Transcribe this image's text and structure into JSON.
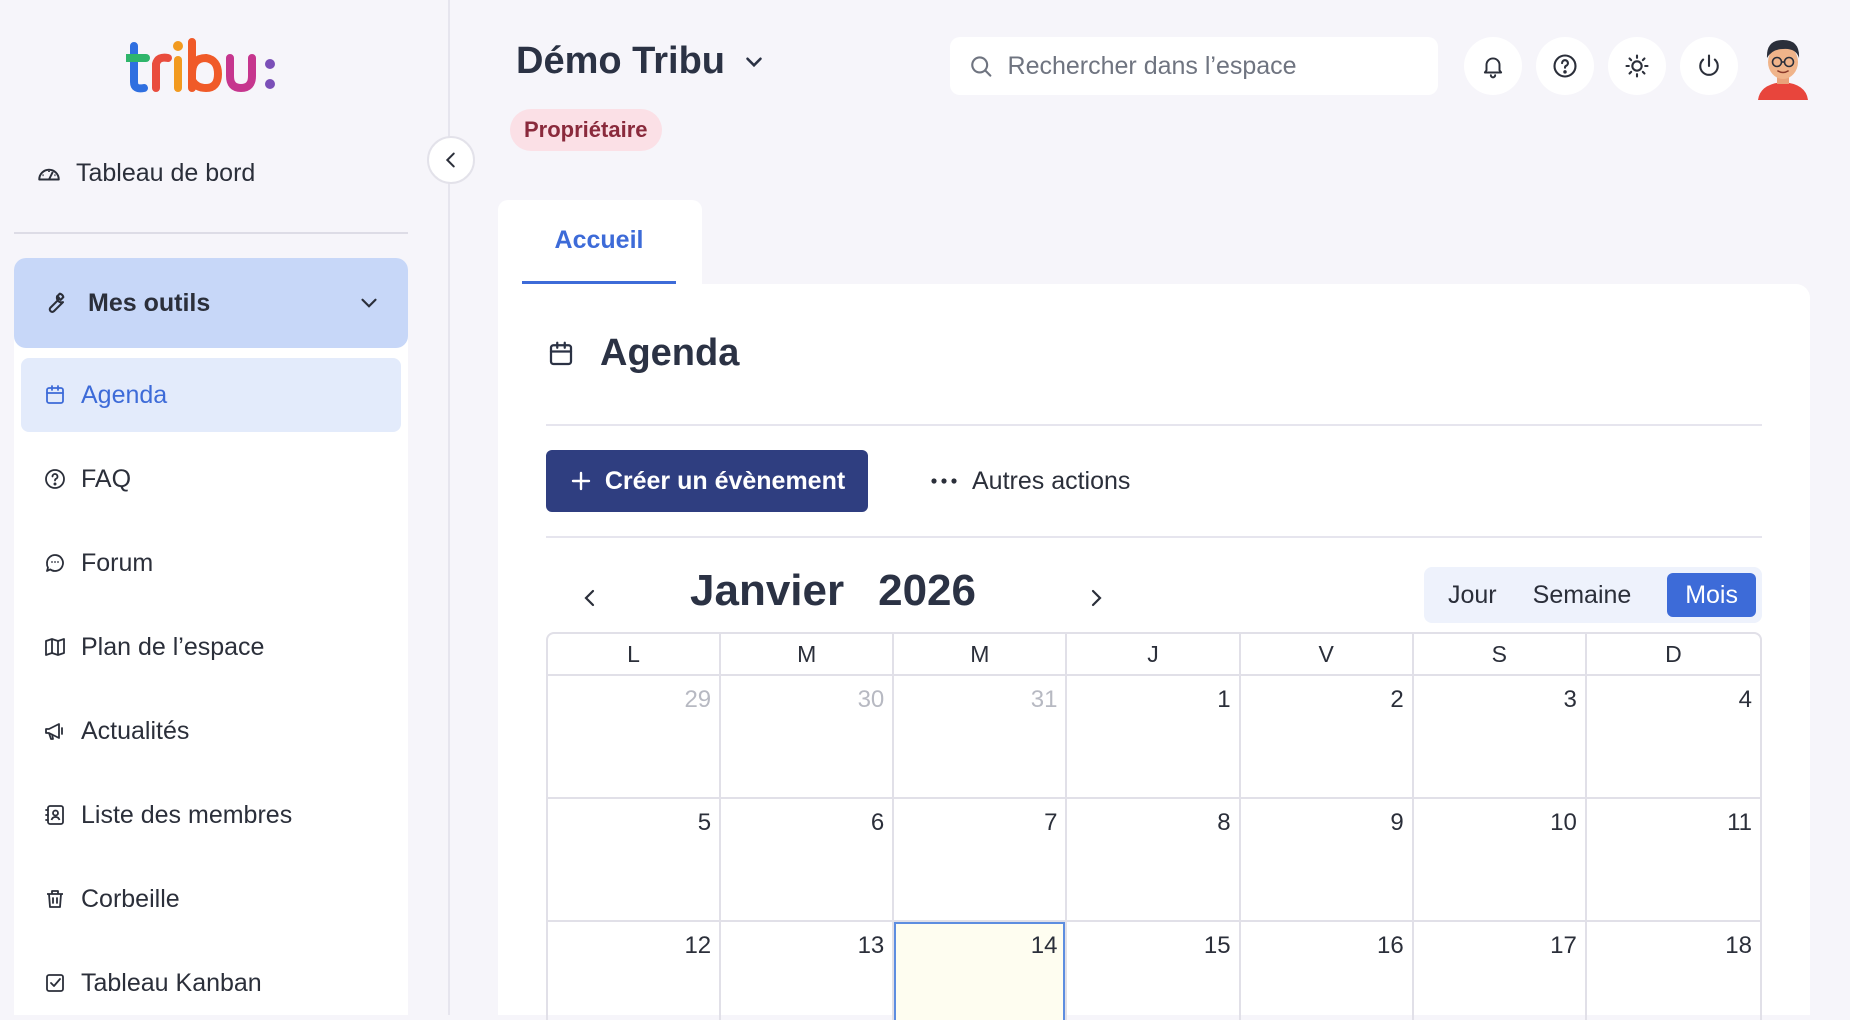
{
  "sidebar": {
    "logo_text": "tribu:",
    "dashboard_label": "Tableau de bord",
    "tools_label": "Mes outils",
    "items": [
      {
        "label": "Agenda",
        "icon": "calendar-icon",
        "active": true
      },
      {
        "label": "FAQ",
        "icon": "help-circle-icon",
        "active": false
      },
      {
        "label": "Forum",
        "icon": "chat-icon",
        "active": false
      },
      {
        "label": "Plan de l’espace",
        "icon": "map-icon",
        "active": false
      },
      {
        "label": "Actualités",
        "icon": "megaphone-icon",
        "active": false
      },
      {
        "label": "Liste des membres",
        "icon": "contacts-icon",
        "active": false
      },
      {
        "label": "Corbeille",
        "icon": "trash-icon",
        "active": false
      },
      {
        "label": "Tableau Kanban",
        "icon": "checkbox-icon",
        "active": false
      }
    ]
  },
  "header": {
    "space_title": "Démo Tribu",
    "role_badge": "Propriétaire",
    "search_placeholder": "Rechercher dans l’espace"
  },
  "tabs": [
    {
      "label": "Accueil",
      "active": true
    }
  ],
  "agenda": {
    "title": "Agenda",
    "create_label": "Créer un évènement",
    "other_actions_label": "Autres actions",
    "month": "Janvier",
    "year": "2026",
    "views": [
      "Jour",
      "Semaine",
      "Mois"
    ],
    "active_view": "Mois",
    "weekdays": [
      "L",
      "M",
      "M",
      "J",
      "V",
      "S",
      "D"
    ],
    "weeks": [
      [
        {
          "d": "29",
          "muted": true
        },
        {
          "d": "30",
          "muted": true
        },
        {
          "d": "31",
          "muted": true
        },
        {
          "d": "1"
        },
        {
          "d": "2"
        },
        {
          "d": "3"
        },
        {
          "d": "4"
        }
      ],
      [
        {
          "d": "5"
        },
        {
          "d": "6"
        },
        {
          "d": "7"
        },
        {
          "d": "8"
        },
        {
          "d": "9"
        },
        {
          "d": "10"
        },
        {
          "d": "11"
        }
      ],
      [
        {
          "d": "12"
        },
        {
          "d": "13"
        },
        {
          "d": "14",
          "today": true
        },
        {
          "d": "15"
        },
        {
          "d": "16"
        },
        {
          "d": "17"
        },
        {
          "d": "18"
        }
      ]
    ]
  },
  "colors": {
    "accent": "#3d6bd8",
    "primary_button": "#2f3e80",
    "badge_bg": "#fbe0e6",
    "tools_header_bg": "#c7d7f8"
  }
}
